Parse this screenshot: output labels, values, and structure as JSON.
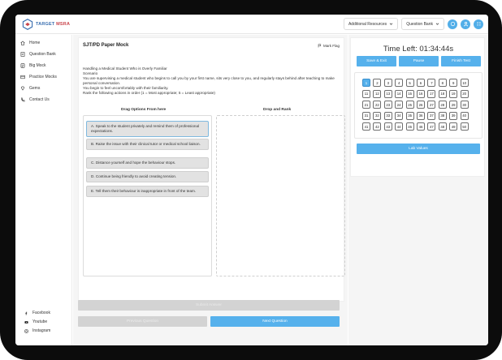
{
  "app": {
    "logo_text": "TARGET",
    "logo_text_accent": "MSRA"
  },
  "header": {
    "additional_resources": "Additional Resources",
    "question_bank": "Question Bank"
  },
  "sidebar": {
    "items": [
      {
        "label": "Home",
        "icon": "home-icon"
      },
      {
        "label": "Question Bank",
        "icon": "question-bank-icon"
      },
      {
        "label": "Big Mock",
        "icon": "big-mock-icon"
      },
      {
        "label": "Practice Mocks",
        "icon": "practice-mocks-icon"
      },
      {
        "label": "Gems",
        "icon": "gems-icon"
      },
      {
        "label": "Contact Us",
        "icon": "contact-icon"
      }
    ],
    "social": [
      {
        "label": "Facebook",
        "icon": "facebook-icon"
      },
      {
        "label": "Youtube",
        "icon": "youtube-icon"
      },
      {
        "label": "Instagram",
        "icon": "instagram-icon"
      }
    ]
  },
  "question": {
    "paper_title": "SJT/PD Paper Mock",
    "mark_flag": "Mark Flag",
    "heading": "Handling a Medical Student Who is Overly Familiar",
    "scenario_label": "Scenario",
    "body_1": "You are supervising a medical student who begins to call you by your first name, sits very close to you, and regularly stays behind after teaching to make personal conversation.",
    "body_2": "You begin to feel uncomfortably with their familiarity.",
    "instruction": "Rank the following actions in order (1 = Most appropriate; 5 = Least appropriate)",
    "drag_header": "Drag Options From here",
    "drop_header": "Drop and Rank",
    "options": [
      "A. Speak to the student privately and remind them of professional expectations.",
      "B. Raise the issue with their clinical tutor or medical school liaison.",
      "C. Distance yourself and hope the behaviour stops.",
      "D. Continue being friendly to avoid creating tension.",
      "E. Tell them their behaviour is inappropriate in front of the team."
    ]
  },
  "actions": {
    "submit": "Submit Answer",
    "previous": "Previous Question",
    "next": "Next Question"
  },
  "timer": {
    "label": "Time Left: 01:34:44s"
  },
  "controls": {
    "save_exit": "Save & Exit",
    "pause": "Pause",
    "finish": "Finish Test"
  },
  "question_grid": {
    "numbers": [
      1,
      2,
      3,
      4,
      5,
      6,
      7,
      8,
      9,
      10,
      11,
      12,
      13,
      14,
      15,
      16,
      17,
      18,
      19,
      20,
      21,
      22,
      23,
      24,
      25,
      26,
      27,
      28,
      29,
      30,
      31,
      32,
      33,
      34,
      35,
      36,
      37,
      38,
      39,
      40,
      41,
      42,
      43,
      44,
      45,
      46,
      47,
      48,
      49,
      50
    ],
    "current": 1
  },
  "lab_values": "Lab Values",
  "colors": {
    "accent": "#56b1ec",
    "disabled": "#d3d3d3",
    "background": "#f5f5f5"
  }
}
